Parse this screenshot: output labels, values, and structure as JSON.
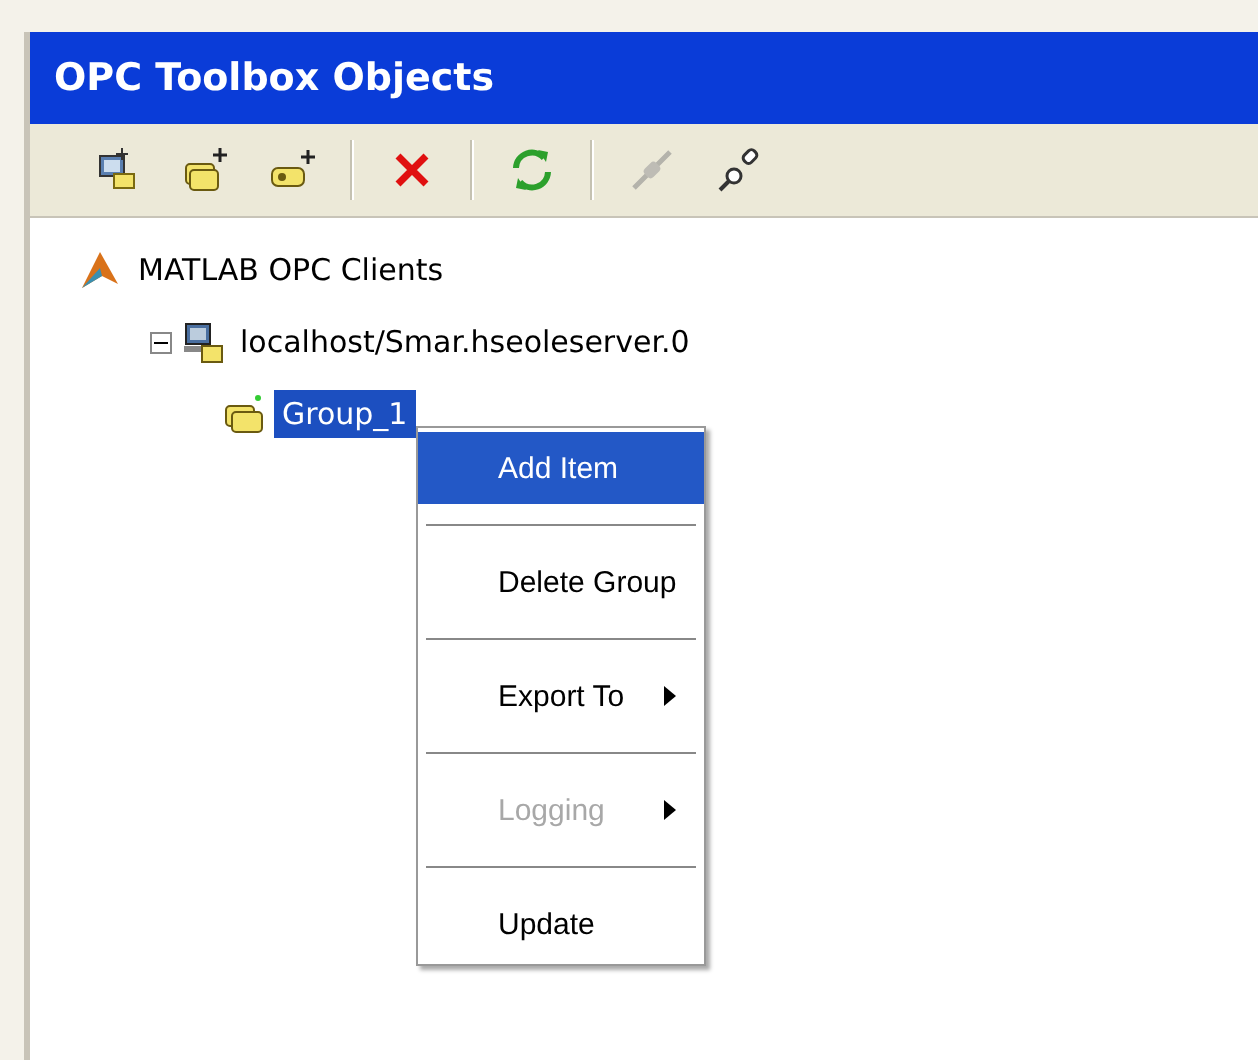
{
  "window": {
    "title": "OPC Toolbox Objects"
  },
  "toolbar": [
    {
      "kind": "new-client",
      "disabled": false
    },
    {
      "kind": "add-group",
      "disabled": false
    },
    {
      "kind": "add-item",
      "disabled": false
    },
    {
      "kind": "separator"
    },
    {
      "kind": "delete",
      "disabled": false
    },
    {
      "kind": "separator"
    },
    {
      "kind": "refresh",
      "disabled": false
    },
    {
      "kind": "separator"
    },
    {
      "kind": "disconnect",
      "disabled": true
    },
    {
      "kind": "connect",
      "disabled": false
    }
  ],
  "tree": [
    {
      "label": "MATLAB OPC Clients",
      "kind": "root",
      "selected": false,
      "children": [
        {
          "label": "localhost/Smar.hseoleserver.0",
          "kind": "client",
          "selected": false,
          "expanded": true,
          "children": [
            {
              "label": "Group_1",
              "kind": "group",
              "selected": true
            }
          ]
        }
      ]
    }
  ],
  "context_menu": [
    {
      "label": "Add Item",
      "selected": true,
      "disabled": false,
      "submenu": false
    },
    {
      "label": "Delete Group",
      "selected": false,
      "disabled": false,
      "submenu": false
    },
    {
      "label": "Export To",
      "selected": false,
      "disabled": false,
      "submenu": true
    },
    {
      "label": "Logging",
      "selected": false,
      "disabled": true,
      "submenu": true
    },
    {
      "label": "Update",
      "selected": false,
      "disabled": false,
      "submenu": false
    }
  ]
}
